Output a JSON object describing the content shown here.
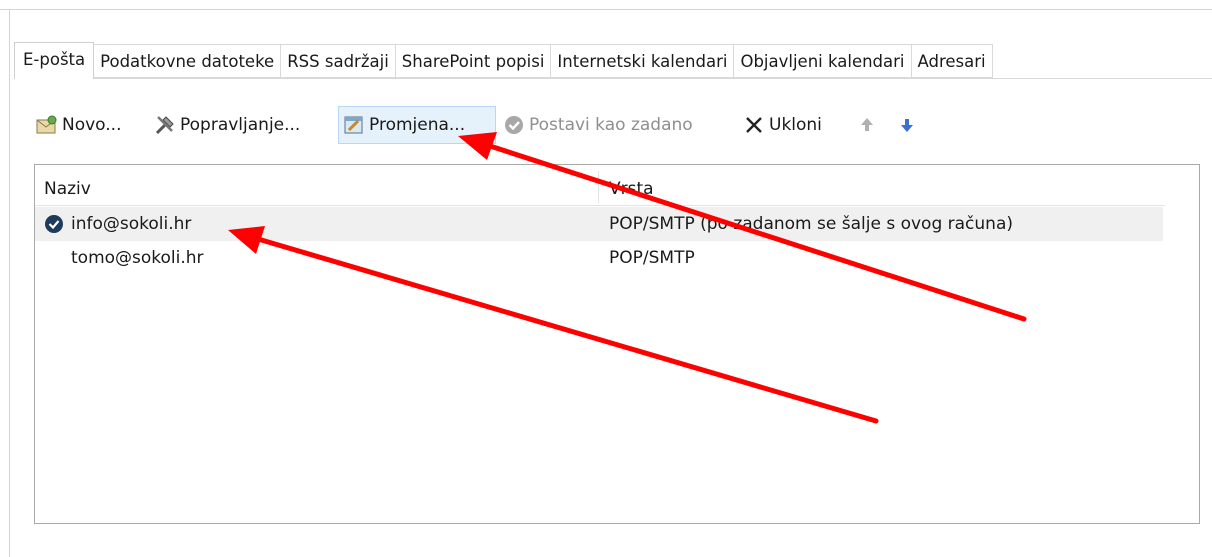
{
  "tabs": [
    {
      "label": "E-pošta"
    },
    {
      "label": "Podatkovne datoteke"
    },
    {
      "label": "RSS sadržaji"
    },
    {
      "label": "SharePoint popisi"
    },
    {
      "label": "Internetski kalendari"
    },
    {
      "label": "Objavljeni kalendari"
    },
    {
      "label": "Adresari"
    }
  ],
  "toolbar": {
    "new_label": "Novo...",
    "repair_label": "Popravljanje...",
    "change_label": "Promjena...",
    "set_default_label": "Postavi kao zadano",
    "remove_label": "Ukloni"
  },
  "list": {
    "columns": [
      "Naziv",
      "Vrsta"
    ],
    "rows": [
      {
        "name": "info@sokoli.hr",
        "type": "POP/SMTP (po zadanom se šalje s ovog računa)",
        "default": true
      },
      {
        "name": "tomo@sokoli.hr",
        "type": "POP/SMTP",
        "default": false
      }
    ]
  },
  "colors": {
    "annotation_arrow": "#ff0000",
    "selected_row": "#f0f0f0",
    "pressed_button": "#e5f1fb",
    "check_badge": "#1f3a5f"
  },
  "icons": [
    "new-mail-icon",
    "repair-tools-icon",
    "change-icon",
    "set-default-check-icon",
    "remove-x-icon",
    "move-up-icon",
    "move-down-icon",
    "default-check-icon"
  ]
}
